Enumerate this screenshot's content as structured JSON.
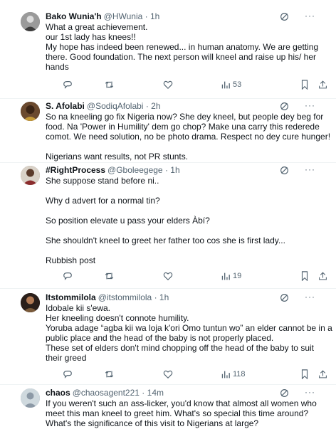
{
  "tweets": [
    {
      "name": "Bako Wunia'h",
      "handle": "@HWunia",
      "dot": "·",
      "time": "1h",
      "lines": [
        "What a great achievement.",
        "our 1st lady has knees!!",
        "My hope has indeed been renewed... in human anatomy. We are getting",
        "there. Good foundation. The next person will kneel and raise up his/ her",
        "hands"
      ],
      "views": "53"
    },
    {
      "name": "S. Afolabi",
      "handle": "@SodiqAfolabi",
      "dot": "·",
      "time": "2h",
      "lines": [
        "So na kneeling go fix Nigeria now? She dey kneel, but people dey beg for",
        "food. Na 'Power in Humility' dem go chop? Make una carry this rederede",
        "comot. We need solution, no be photo drama. Respect no dey cure hunger!",
        "",
        "Nigerians want results, not PR stunts."
      ]
    },
    {
      "name": "#RightProcess",
      "handle": "@Gboleegege",
      "dot": "·",
      "time": "1h",
      "lines": [
        "She suppose stand before ni..",
        "",
        "Why d advert for a normal tin?",
        "",
        "So position elevate u pass your elders Àbí?",
        "",
        "She shouldn't kneel to greet her father too cos she is first lady...",
        "",
        "Rubbish post"
      ],
      "views": "19"
    },
    {
      "name": "Itstommilola",
      "handle": "@itstommilola",
      "dot": "·",
      "time": "1h",
      "lines": [
        "Idobale kii s'ewa.",
        "Her kneeling doesn't connote humility.",
        "Yoruba adage “agba kii wa loja k'ori Omo tuntun wo” an elder cannot be in a",
        "public place and the head of the baby is not properly placed.",
        "These set of elders don't mind chopping off the head of the baby to suit",
        "their greed"
      ],
      "views": "118"
    },
    {
      "name": "chaos",
      "handle": "@chaosagent221",
      "dot": "·",
      "time": "14m",
      "lines": [
        "If you weren't such an ass-licker, you'd know that almost all women who",
        "meet this man kneel to greet him. What's so special this time around?",
        "What's the significance of this visit to Nigerians at large?"
      ]
    }
  ],
  "icons": {
    "more": "more-icon",
    "grok": "grok-icon",
    "reply": "reply-icon",
    "retweet": "retweet-icon",
    "like": "like-icon",
    "views": "views-icon",
    "bookmark": "bookmark-icon",
    "share": "share-icon"
  },
  "colors": {
    "text": "#0f1419",
    "secondary": "#536471",
    "divider": "#eff3f4"
  }
}
